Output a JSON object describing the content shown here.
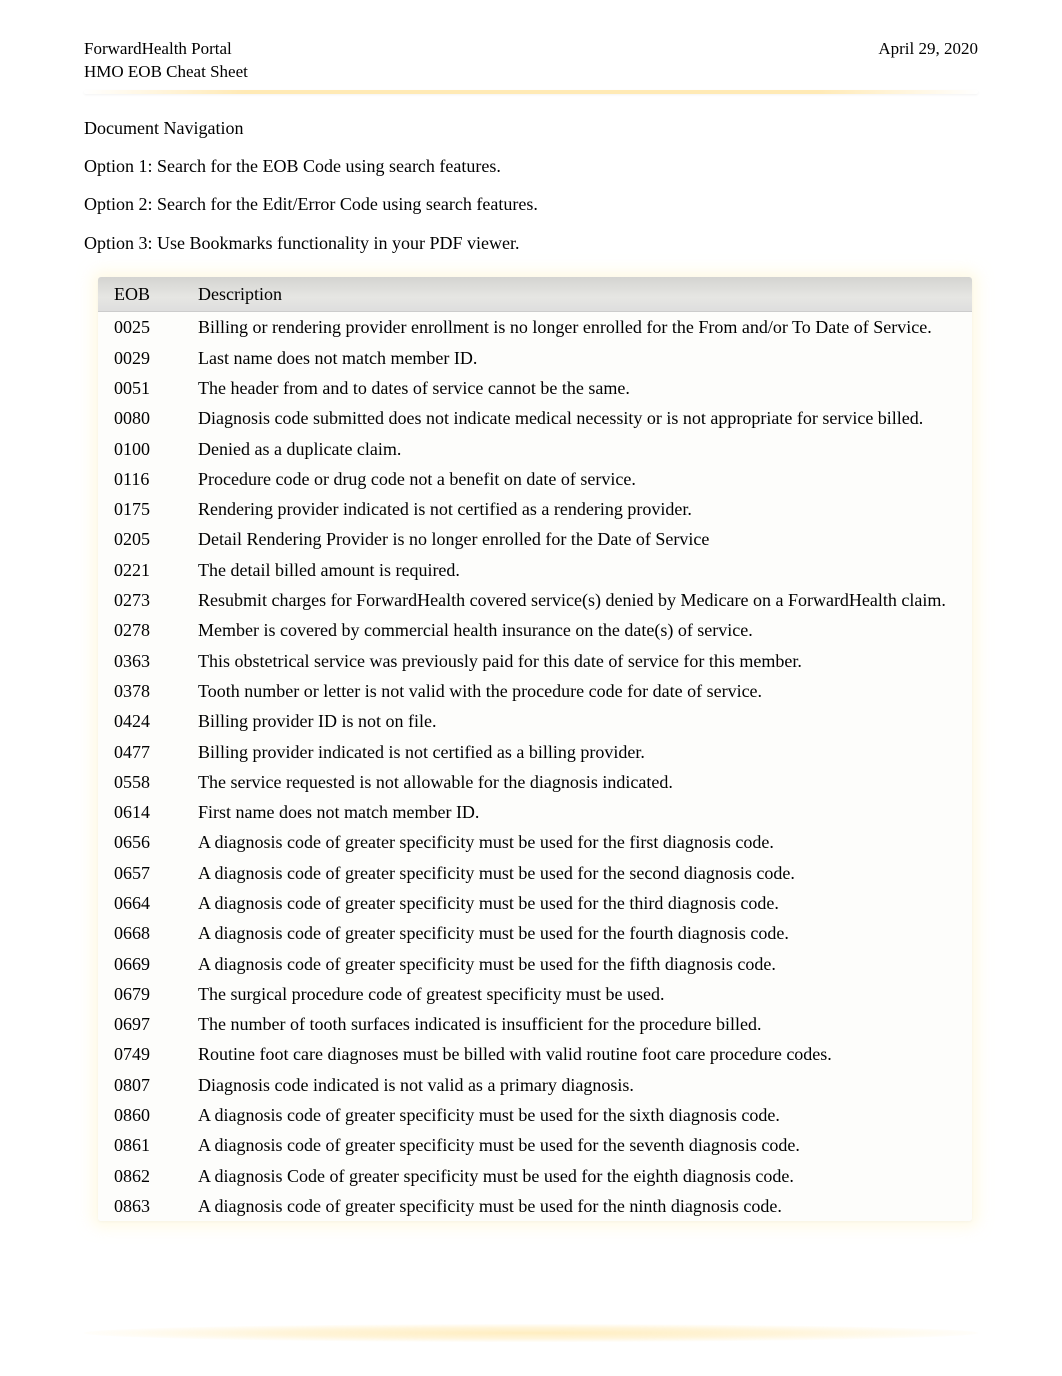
{
  "header": {
    "left_line1": "ForwardHealth Portal",
    "left_line2": "HMO EOB Cheat Sheet",
    "right": "April 29, 2020"
  },
  "nav": {
    "title": "Document Navigation",
    "options": [
      "Option 1: Search for the EOB Code using search features.",
      "Option 2: Search for the Edit/Error Code using search features.",
      "Option 3: Use Bookmarks functionality in your PDF viewer."
    ]
  },
  "table": {
    "col1": "EOB",
    "col2": "Description",
    "rows": [
      {
        "code": "0025",
        "desc": "Billing or rendering provider enrollment is no longer enrolled for the From and/or To Date of Service."
      },
      {
        "code": "0029",
        "desc": "Last name does not match member ID."
      },
      {
        "code": "0051",
        "desc": "The header from and to dates of service cannot be the same."
      },
      {
        "code": "0080",
        "desc": "Diagnosis code submitted does not indicate medical necessity or is not appropriate for service billed."
      },
      {
        "code": "0100",
        "desc": "Denied as a duplicate claim."
      },
      {
        "code": "0116",
        "desc": "Procedure code or drug code not a benefit on date of service."
      },
      {
        "code": "0175",
        "desc": "Rendering provider indicated is not certified as a rendering provider."
      },
      {
        "code": "0205",
        "desc": "Detail Rendering Provider is no longer enrolled for the Date of Service"
      },
      {
        "code": "0221",
        "desc": "The detail billed amount is required."
      },
      {
        "code": "0273",
        "desc": "Resubmit charges for ForwardHealth covered service(s) denied by Medicare on a ForwardHealth claim."
      },
      {
        "code": "0278",
        "desc": "Member is covered by commercial health insurance on the date(s) of service."
      },
      {
        "code": "0363",
        "desc": "This obstetrical service was previously paid for this date of service for this member."
      },
      {
        "code": "0378",
        "desc": "Tooth number or letter is not valid with the procedure code for date of service."
      },
      {
        "code": "0424",
        "desc": "Billing provider ID is not on file."
      },
      {
        "code": "0477",
        "desc": "Billing provider indicated is not certified as a billing provider."
      },
      {
        "code": "0558",
        "desc": "The service requested is not allowable for the diagnosis indicated."
      },
      {
        "code": "0614",
        "desc": "First name does not match member ID."
      },
      {
        "code": "0656",
        "desc": "A diagnosis code of greater specificity must be used for the first diagnosis code."
      },
      {
        "code": "0657",
        "desc": "A diagnosis code of greater specificity must be used for the second diagnosis code."
      },
      {
        "code": "0664",
        "desc": "A diagnosis code of greater specificity must be used for the third diagnosis code."
      },
      {
        "code": "0668",
        "desc": "A diagnosis code of greater specificity must be used for the fourth diagnosis code."
      },
      {
        "code": "0669",
        "desc": "A diagnosis code of greater specificity must be used for the fifth diagnosis code."
      },
      {
        "code": "0679",
        "desc": "The surgical procedure code of greatest specificity must be used."
      },
      {
        "code": "0697",
        "desc": "The number of tooth surfaces indicated is insufficient for the procedure billed."
      },
      {
        "code": "0749",
        "desc": "Routine foot care diagnoses must be billed with valid routine foot care procedure codes."
      },
      {
        "code": "0807",
        "desc": "Diagnosis code indicated is not valid as a primary diagnosis."
      },
      {
        "code": "0860",
        "desc": "A diagnosis code of greater specificity must be used for the sixth diagnosis code."
      },
      {
        "code": "0861",
        "desc": "A diagnosis code of greater specificity must be used for the seventh diagnosis code."
      },
      {
        "code": "0862",
        "desc": "A diagnosis Code of greater specificity must be used for the eighth diagnosis code."
      },
      {
        "code": "0863",
        "desc": "A diagnosis code of greater specificity must be used for the ninth diagnosis code."
      }
    ]
  }
}
